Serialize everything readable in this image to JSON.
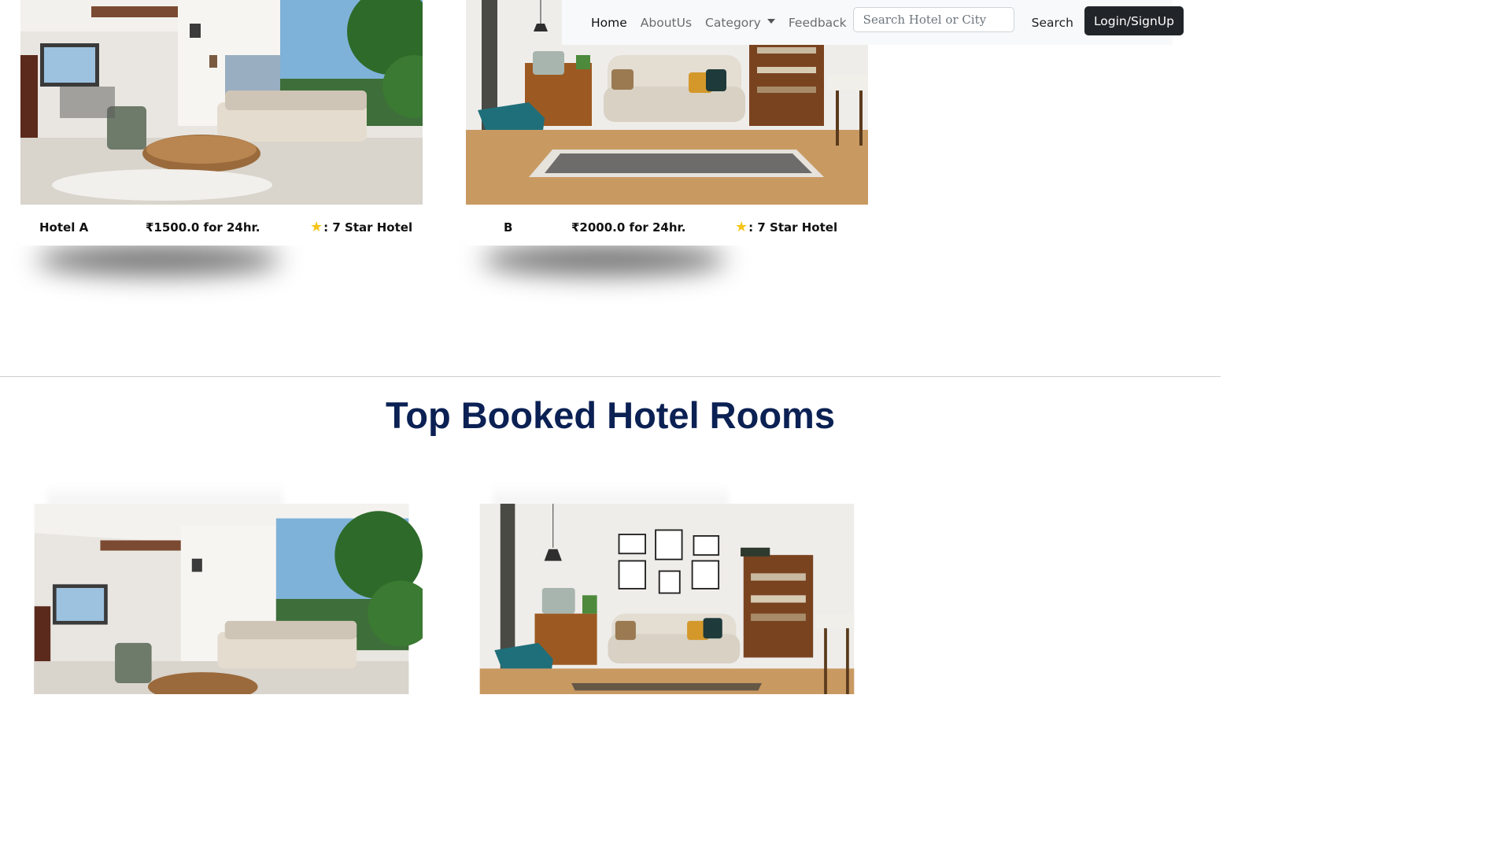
{
  "navbar": {
    "links": [
      {
        "label": "Home",
        "active": true
      },
      {
        "label": "AboutUs",
        "active": false
      },
      {
        "label": "Category",
        "active": false
      },
      {
        "label": "Feedback",
        "active": false
      }
    ],
    "search_placeholder": "Search Hotel or City",
    "search_button": "Search",
    "login_button": "Login/SignUp"
  },
  "hotels": [
    {
      "name": "Hotel A",
      "price": "₹1500.0 for 24hr.",
      "rating": ": 7 Star Hotel"
    },
    {
      "name": "B",
      "price": "₹2000.0 for 24hr.",
      "rating": ": 7 Star Hotel"
    }
  ],
  "section": {
    "title": "Top Booked Hotel Rooms"
  },
  "colors": {
    "title": "#0b2154",
    "login_bg": "#212529",
    "navbar_bg": "#f8f9fa",
    "star": "#f5c518"
  },
  "icons": {
    "rating": "star-icon",
    "dropdown": "chevron-down-icon"
  }
}
